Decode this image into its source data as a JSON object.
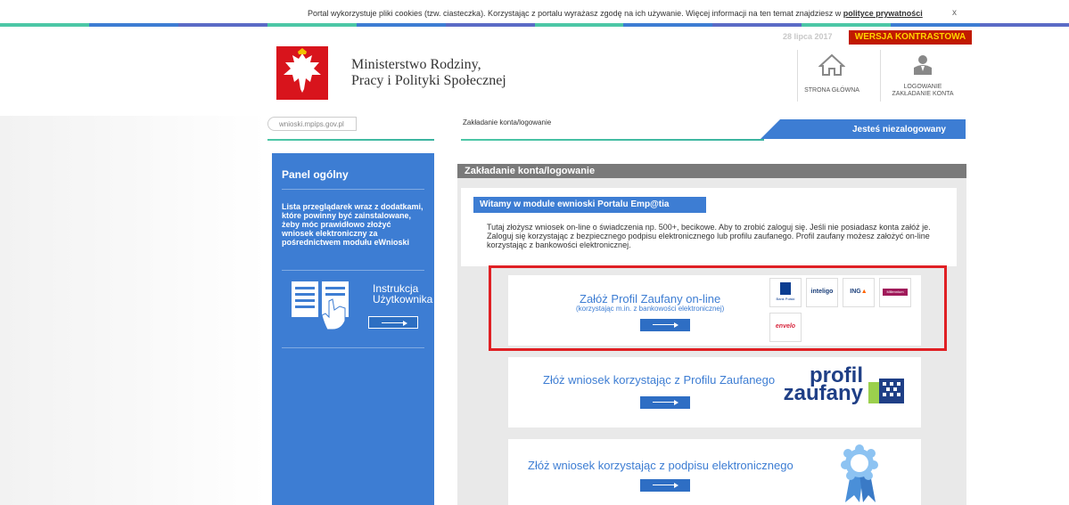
{
  "cookie_bar": {
    "text": "Portal wykorzystuje pliki cookies (tzw. ciasteczka). Korzystając z portalu wyrażasz zgodę na ich używanie. Więcej informacji na ten temat znajdziesz w",
    "link": "polityce prywatności",
    "close": "x"
  },
  "header": {
    "date": "28 lipca 2017",
    "contrast_label": "WERSJA KONTRASTOWA",
    "ministry_line1": "Ministerstwo Rodziny,",
    "ministry_line2": "Pracy i Polityki Społecznej",
    "nav": [
      {
        "label": "STRONA GŁÓWNA",
        "icon": "home-icon"
      },
      {
        "label_line1": "LOGOWANIE",
        "label_line2": "ZAKŁADANIE KONTA",
        "icon": "user-icon"
      }
    ]
  },
  "breadcrumb": {
    "site": "wnioski.mpips.gov.pl",
    "section": "Zakładanie konta/logowanie"
  },
  "status": {
    "label": "Jesteś niezalogowany"
  },
  "sidebar": {
    "title": "Panel ogólny",
    "info_text": "Lista przeglądarek wraz z dodatkami, które powinny być zainstalowane, żeby móc prawidłowo złożyć wniosek elektroniczny za pośrednictwem modułu eWnioski",
    "manual_line1": "Instrukcja",
    "manual_line2": "Użytkownika"
  },
  "main": {
    "header": "Zakładanie konta/logowanie",
    "welcome_title": "Witamy w module ewnioski Portalu Emp@tia",
    "welcome_text": "Tutaj złożysz wniosek on-line o świadczenia np. 500+, becikowe. Aby to zrobić zaloguj się. Jeśli nie posiadasz konta załóż je. Zaloguj się korzystając z bezpiecznego podpisu elektronicznego lub profilu zaufanego. Profil zaufany możesz założyć on-line korzystając z bankowości elektronicznej.",
    "cards": [
      {
        "title": "Załóż Profil Zaufany on-line",
        "subtitle": "(korzystając m.in. z bankowości elektronicznej)"
      },
      {
        "title": "Złóż wniosek korzystając z Profilu Zaufanego",
        "logo_line1": "profil",
        "logo_line2": "zaufany"
      },
      {
        "title": "Złóż wniosek korzystając z podpisu elektronicznego"
      }
    ],
    "banks": [
      {
        "name": "Bank Polski",
        "color": "#0b3d91"
      },
      {
        "name": "inteligo",
        "color": "#1b3f7a"
      },
      {
        "name": "ING",
        "color": "#ff6200"
      },
      {
        "name": "Millennium",
        "color": "#a01a5a"
      },
      {
        "name": "envelo",
        "color": "#d7263d"
      }
    ]
  },
  "colors": {
    "accent": "#3d7dd3",
    "header_gray": "#7a7a7a",
    "alert_red": "#e02024",
    "contrast_bg": "#c11a00"
  }
}
